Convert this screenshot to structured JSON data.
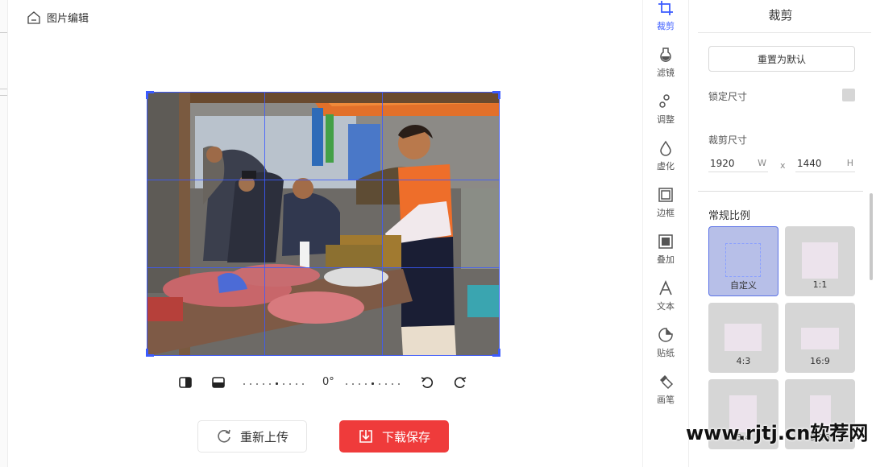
{
  "header": {
    "title": "图片编辑",
    "home_icon": "home-icon"
  },
  "rotate_bar": {
    "angle": "0°"
  },
  "actions": {
    "reupload_label": "重新上传",
    "save_label": "下载保存"
  },
  "tools": [
    {
      "label": "裁剪",
      "icon": "crop-icon",
      "active": true
    },
    {
      "label": "滤镜",
      "icon": "filter-icon"
    },
    {
      "label": "调整",
      "icon": "adjust-icon"
    },
    {
      "label": "虚化",
      "icon": "blur-icon"
    },
    {
      "label": "边框",
      "icon": "border-icon"
    },
    {
      "label": "叠加",
      "icon": "overlay-icon"
    },
    {
      "label": "文本",
      "icon": "text-icon"
    },
    {
      "label": "贴纸",
      "icon": "sticker-icon"
    },
    {
      "label": "画笔",
      "icon": "brush-icon"
    }
  ],
  "panel": {
    "title": "裁剪",
    "reset_label": "重置为默认",
    "lock_label": "锁定尺寸",
    "size_label": "裁剪尺寸",
    "width_value": "1920",
    "width_unit": "W",
    "separator": "x",
    "height_value": "1440",
    "height_unit": "H",
    "ratio_section_label": "常规比例",
    "ratios": [
      {
        "label": "自定义",
        "selected": true
      },
      {
        "label": "1:1"
      },
      {
        "label": "4:3"
      },
      {
        "label": "16:9"
      },
      {
        "label": "3:4"
      },
      {
        "label": "9:16"
      }
    ]
  },
  "colors": {
    "accent": "#3b5bff",
    "save_button": "#ef3b3b"
  },
  "watermark": "www.rjtj.cn软荐网"
}
